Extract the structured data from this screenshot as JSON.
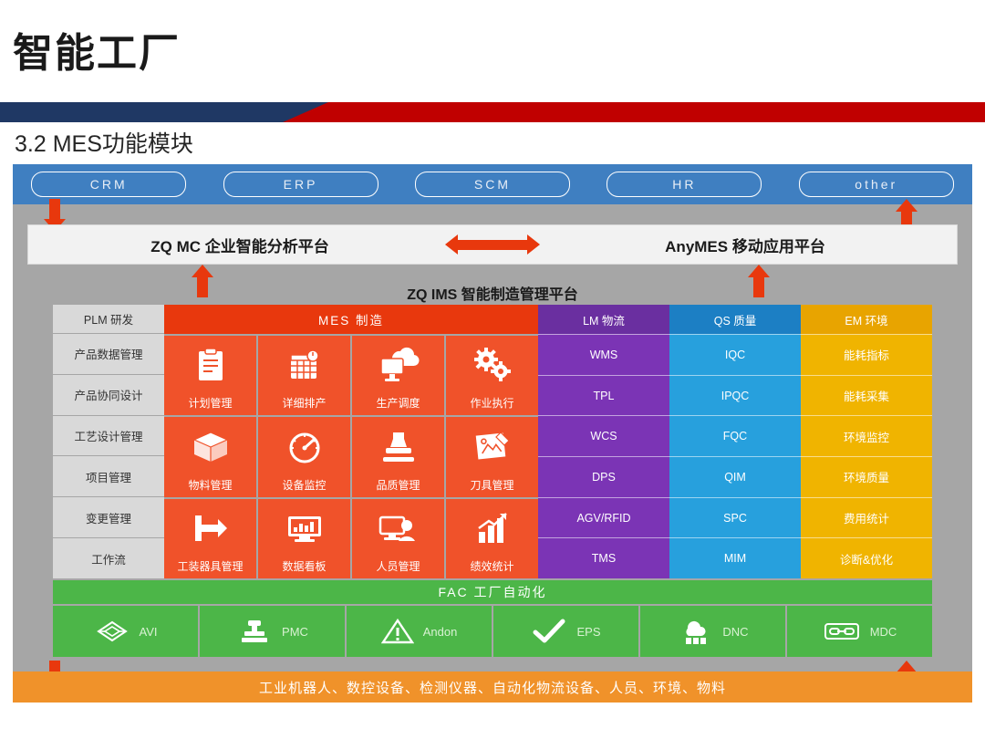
{
  "header": {
    "title": "智能工厂",
    "subtitle": "3.2 MES功能模块"
  },
  "diagram": {
    "top_systems": [
      "CRM",
      "ERP",
      "SCM",
      "HR",
      "other"
    ],
    "platforms": {
      "left": "ZQ MC 企业智能分析平台",
      "right": "AnyMES 移动应用平台",
      "center_arrow": "bidirectional-arrow"
    },
    "ims_title": "ZQ IMS 智能制造管理平台",
    "plm": {
      "head": "PLM 研发",
      "items": [
        "产品数据管理",
        "产品协同设计",
        "工艺设计管理",
        "项目管理",
        "变更管理",
        "工作流"
      ]
    },
    "mes": {
      "head": "MES 制造",
      "tiles": [
        {
          "label": "计划管理",
          "icon": "clipboard-icon"
        },
        {
          "label": "详细排产",
          "icon": "calendar-icon"
        },
        {
          "label": "生产调度",
          "icon": "monitor-cloud-icon"
        },
        {
          "label": "作业执行",
          "icon": "gears-icon"
        },
        {
          "label": "物料管理",
          "icon": "box-icon"
        },
        {
          "label": "设备监控",
          "icon": "gauge-icon"
        },
        {
          "label": "品质管理",
          "icon": "stamp-icon"
        },
        {
          "label": "刀具管理",
          "icon": "tools-icon"
        },
        {
          "label": "工装器具管理",
          "icon": "fixture-icon"
        },
        {
          "label": "数据看板",
          "icon": "dashboard-icon"
        },
        {
          "label": "人员管理",
          "icon": "person-screen-icon"
        },
        {
          "label": "绩效统计",
          "icon": "bar-chart-icon"
        }
      ]
    },
    "lm": {
      "head": "LM 物流",
      "items": [
        "WMS",
        "TPL",
        "WCS",
        "DPS",
        "AGV/RFID",
        "TMS"
      ]
    },
    "qs": {
      "head": "QS 质量",
      "items": [
        "IQC",
        "IPQC",
        "FQC",
        "QIM",
        "SPC",
        "MIM"
      ]
    },
    "em": {
      "head": "EM 环境",
      "items": [
        "能耗指标",
        "能耗采集",
        "环境监控",
        "环境质量",
        "费用统计",
        "诊断&优化"
      ]
    },
    "fac": {
      "head": "FAC 工厂自动化",
      "tiles": [
        {
          "label": "AVI",
          "icon": "network-node-icon"
        },
        {
          "label": "PMC",
          "icon": "press-machine-icon"
        },
        {
          "label": "Andon",
          "icon": "warning-triangle-icon"
        },
        {
          "label": "EPS",
          "icon": "check-icon"
        },
        {
          "label": "DNC",
          "icon": "cloud-machines-icon"
        },
        {
          "label": "MDC",
          "icon": "link-chain-icon"
        }
      ]
    },
    "bottom_bar": "工业机器人、数控设备、检测仪器、自动化物流设备、人员、环境、物料",
    "colors": {
      "top_band": "#3f7fc1",
      "mes": "#f0522a",
      "lm": "#7b34b5",
      "qs": "#27a0dd",
      "em": "#f0b400",
      "fac": "#4cb648",
      "bottom": "#f0922a",
      "accent_red": "#c00000",
      "arrow_red": "#e8380d"
    }
  }
}
